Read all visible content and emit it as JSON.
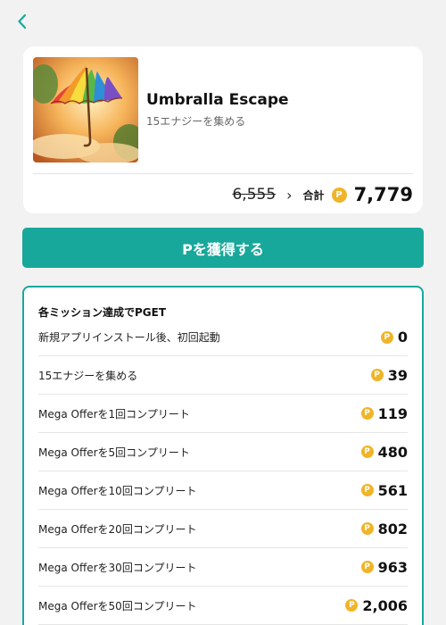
{
  "nav": {
    "back_icon": "chevron-left-icon"
  },
  "app": {
    "name": "Umbralla Escape",
    "subtitle": "15エナジーを集める",
    "old_points": "6,555",
    "arrow": "›",
    "total_label": "合計",
    "total_points": "7,779",
    "coin_symbol": "P"
  },
  "cta": {
    "label": "Pを獲得する"
  },
  "missions": {
    "title": "各ミッション達成でPGET",
    "items": [
      {
        "label": "新規アプリインストール後、初回起動",
        "points": "0"
      },
      {
        "label": "15エナジーを集める",
        "points": "39"
      },
      {
        "label": "Mega Offerを1回コンプリート",
        "points": "119"
      },
      {
        "label": "Mega Offerを5回コンプリート",
        "points": "480"
      },
      {
        "label": "Mega Offerを10回コンプリート",
        "points": "561"
      },
      {
        "label": "Mega Offerを20回コンプリート",
        "points": "802"
      },
      {
        "label": "Mega Offerを30回コンプリート",
        "points": "963"
      },
      {
        "label": "Mega Offerを50回コンプリート",
        "points": "2,006"
      }
    ]
  },
  "colors": {
    "accent": "#17a89b",
    "coin": "#f0b428",
    "background": "#f2f2f2"
  }
}
